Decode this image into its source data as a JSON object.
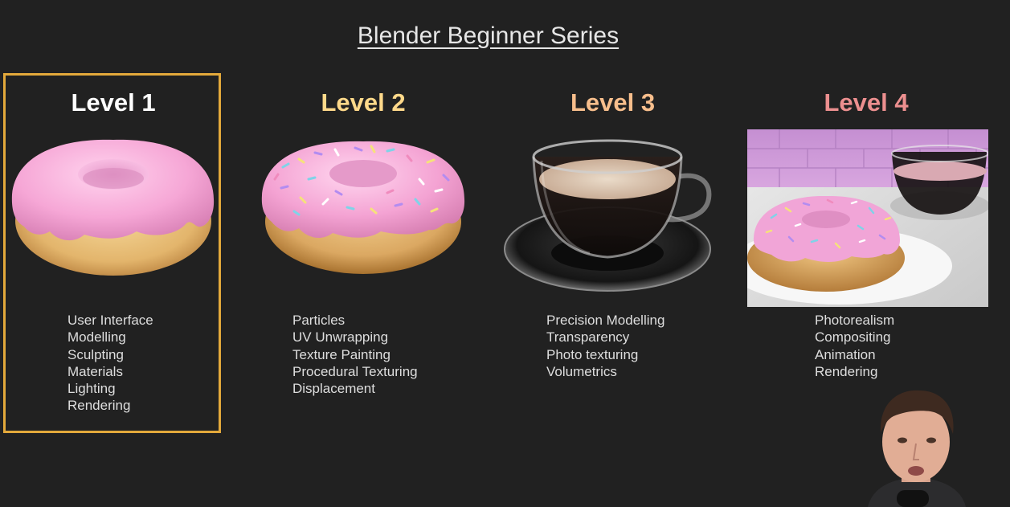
{
  "header": {
    "title": "Blender Beginner Series"
  },
  "levels": [
    {
      "label": "Level 1",
      "color": "#ffffff",
      "selected": true,
      "image": "plain-pink-donut",
      "features": [
        "User Interface",
        "Modelling",
        "Sculpting",
        "Materials",
        "Lighting",
        "Rendering"
      ]
    },
    {
      "label": "Level 2",
      "color": "#ffd98a",
      "selected": false,
      "image": "sprinkled-donut",
      "features": [
        "Particles",
        "UV Unwrapping",
        "Texture Painting",
        "Procedural Texturing",
        "Displacement"
      ]
    },
    {
      "label": "Level 3",
      "color": "#f7be8c",
      "selected": false,
      "image": "coffee-cup",
      "features": [
        "Precision Modelling",
        "Transparency",
        "Photo texturing",
        "Volumetrics"
      ]
    },
    {
      "label": "Level 4",
      "color": "#ec8f8f",
      "selected": false,
      "image": "photoreal-donut-scene",
      "features": [
        "Photorealism",
        "Compositing",
        "Animation",
        "Rendering"
      ]
    }
  ],
  "colors": {
    "background": "#212121",
    "highlight_border": "#e3a93b",
    "text": "#dedede"
  },
  "presenter": {
    "image": "presenter-webcam"
  }
}
